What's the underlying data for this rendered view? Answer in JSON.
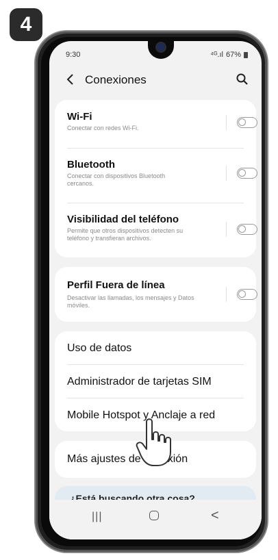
{
  "step": {
    "number": "4"
  },
  "status_bar": {
    "time": "9:30",
    "signal": "⁴ᴳ.ıl",
    "battery": "67%"
  },
  "header": {
    "back_icon": "chevron-left-icon",
    "title": "Conexiones",
    "search_icon": "search-icon"
  },
  "card1": {
    "items": [
      {
        "title": "Wi-Fi",
        "subtitle": "Conectar con redes Wi-Fi.",
        "toggle_on": false
      },
      {
        "title": "Bluetooth",
        "subtitle": "Conectar con dispositivos Bluetooth cercanos.",
        "toggle_on": false
      },
      {
        "title": "Visibilidad del teléfono",
        "subtitle": "Permite que otros dispositivos detecten su teléfono y transfieran archivos.",
        "toggle_on": false
      }
    ]
  },
  "card2": {
    "items": [
      {
        "title": "Perfil Fuera de línea",
        "subtitle": "Desactivar las llamadas, los mensajes y Datos móviles.",
        "toggle_on": false
      }
    ]
  },
  "card3": {
    "items": [
      {
        "title": "Uso de datos"
      },
      {
        "title": "Administrador de tarjetas SIM"
      },
      {
        "title": "Mobile Hotspot y Anclaje a red"
      }
    ]
  },
  "card4": {
    "items": [
      {
        "title": "Más ajustes de conexión"
      }
    ]
  },
  "suggestion": {
    "text": "¿Está buscando otra cosa?"
  },
  "navbar": {
    "recents_icon": "recents-icon",
    "home_icon": "home-icon",
    "back_icon": "back-icon",
    "recents_glyph": "|||",
    "back_glyph": "<"
  },
  "colors": {
    "screen_bg": "#f2f2f2",
    "card_bg": "#ffffff",
    "suggestion_bg": "#e3ebf2",
    "phone_frame": "#1f1f1f"
  }
}
